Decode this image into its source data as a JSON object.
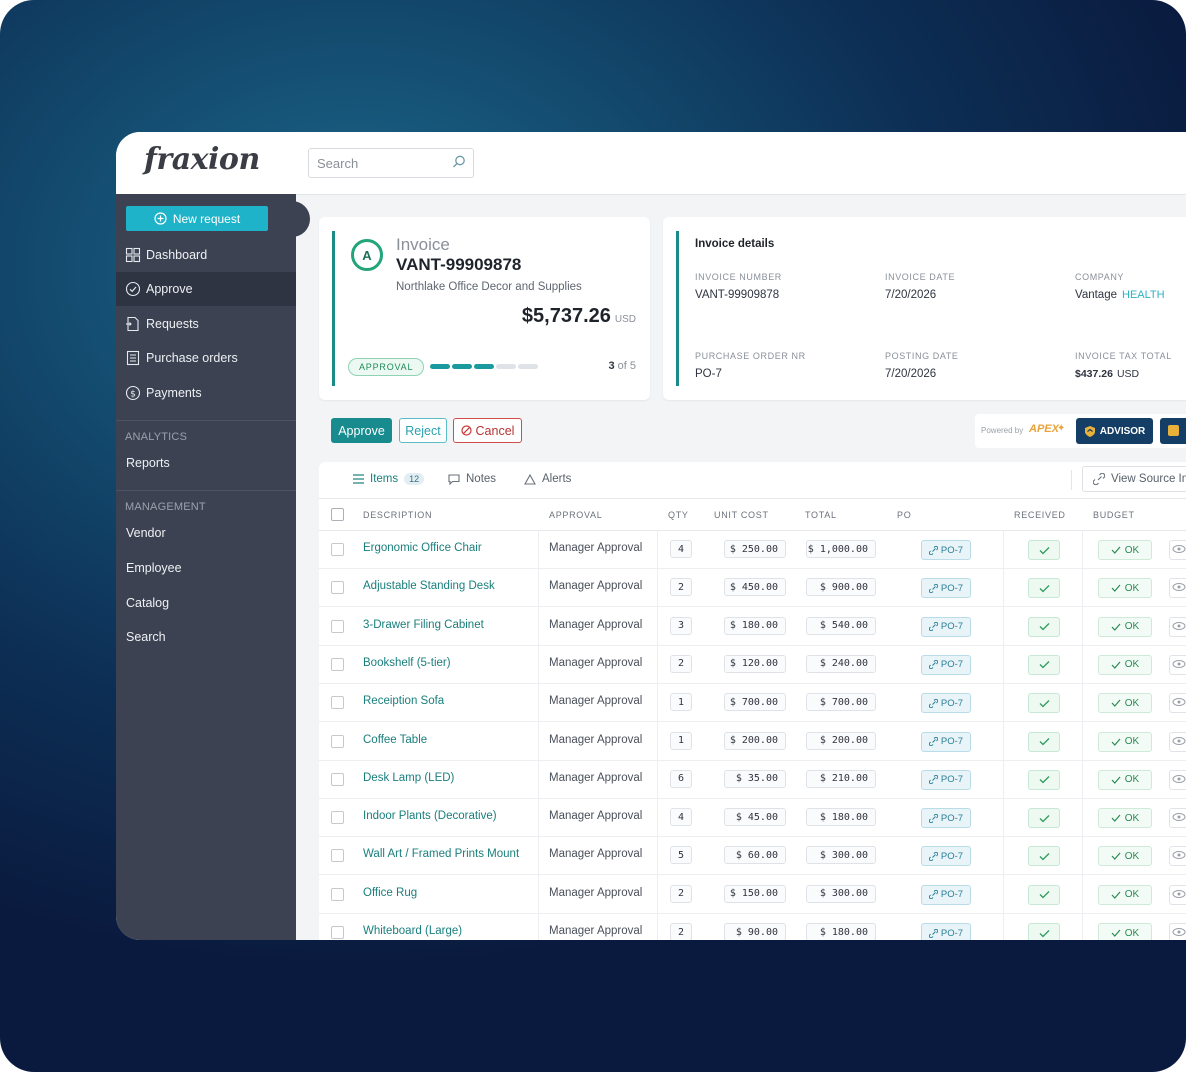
{
  "app": {
    "logo": "fraxion",
    "search_placeholder": "Search"
  },
  "sidebar": {
    "new_request": "New request",
    "items": [
      {
        "label": "Dashboard",
        "icon": "dashboard-icon"
      },
      {
        "label": "Approve",
        "icon": "check-circle-icon",
        "active": true
      },
      {
        "label": "Requests",
        "icon": "request-icon"
      },
      {
        "label": "Purchase orders",
        "icon": "document-icon"
      },
      {
        "label": "Payments",
        "icon": "dollar-icon"
      }
    ],
    "analytics_label": "ANALYTICS",
    "reports": "Reports",
    "management_label": "MANAGEMENT",
    "management": [
      "Vendor",
      "Employee",
      "Catalog",
      "Search"
    ]
  },
  "invoice": {
    "avatar": "A",
    "type": "Invoice",
    "number": "VANT-99909878",
    "vendor": "Northlake Office Decor and Supplies",
    "amount": "$5,737.26",
    "currency": "USD",
    "stage": "APPROVAL",
    "step": "3",
    "step_of": "of 5",
    "progress_filled": 3,
    "progress_total": 5
  },
  "details": {
    "title": "Invoice details",
    "invoice_number_label": "INVOICE NUMBER",
    "invoice_number": "VANT-99909878",
    "invoice_date_label": "INVOICE DATE",
    "invoice_date": "7/20/2026",
    "company_label": "COMPANY",
    "company": "Vantage",
    "company_tag": "HEALTH",
    "po_nr_label": "PURCHASE ORDER NR",
    "po_nr": "PO-7",
    "posting_date_label": "POSTING DATE",
    "posting_date": "7/20/2026",
    "tax_label": "INVOICE TAX TOTAL",
    "tax": "$437.26",
    "tax_currency": "USD"
  },
  "actions": {
    "approve": "Approve",
    "reject": "Reject",
    "cancel": "Cancel",
    "powered_by": "Powered by",
    "apex": "APEX",
    "advisor": "ADVISOR"
  },
  "tabs": {
    "items": "Items",
    "items_count": "12",
    "notes": "Notes",
    "alerts": "Alerts",
    "view_source": "View Source In"
  },
  "columns": {
    "description": "DESCRIPTION",
    "approval": "APPROVAL",
    "qty": "QTY",
    "unit_cost": "UNIT COST",
    "total": "TOTAL",
    "po": "PO",
    "received": "RECEIVED",
    "budget": "BUDGET"
  },
  "rows": [
    {
      "desc": "Ergonomic Office Chair",
      "approval": "Manager Approval",
      "qty": "4",
      "unit": "$ 250.00",
      "total": "$ 1,000.00",
      "po": "PO-7",
      "budget": "OK"
    },
    {
      "desc": "Adjustable Standing Desk",
      "approval": "Manager Approval",
      "qty": "2",
      "unit": "$ 450.00",
      "total": "$ 900.00",
      "po": "PO-7",
      "budget": "OK"
    },
    {
      "desc": "3-Drawer Filing Cabinet",
      "approval": "Manager Approval",
      "qty": "3",
      "unit": "$ 180.00",
      "total": "$ 540.00",
      "po": "PO-7",
      "budget": "OK"
    },
    {
      "desc": "Bookshelf (5-tier)",
      "approval": "Manager Approval",
      "qty": "2",
      "unit": "$ 120.00",
      "total": "$ 240.00",
      "po": "PO-7",
      "budget": "OK"
    },
    {
      "desc": "Receiption Sofa",
      "approval": "Manager Approval",
      "qty": "1",
      "unit": "$ 700.00",
      "total": "$ 700.00",
      "po": "PO-7",
      "budget": "OK"
    },
    {
      "desc": "Coffee Table",
      "approval": "Manager Approval",
      "qty": "1",
      "unit": "$ 200.00",
      "total": "$ 200.00",
      "po": "PO-7",
      "budget": "OK"
    },
    {
      "desc": "Desk Lamp (LED)",
      "approval": "Manager Approval",
      "qty": "6",
      "unit": "$ 35.00",
      "total": "$ 210.00",
      "po": "PO-7",
      "budget": "OK"
    },
    {
      "desc": "Indoor Plants (Decorative)",
      "approval": "Manager Approval",
      "qty": "4",
      "unit": "$ 45.00",
      "total": "$ 180.00",
      "po": "PO-7",
      "budget": "OK"
    },
    {
      "desc": "Wall Art / Framed Prints Mount",
      "approval": "Manager Approval",
      "qty": "5",
      "unit": "$ 60.00",
      "total": "$ 300.00",
      "po": "PO-7",
      "budget": "OK"
    },
    {
      "desc": "Office Rug",
      "approval": "Manager Approval",
      "qty": "2",
      "unit": "$ 150.00",
      "total": "$ 300.00",
      "po": "PO-7",
      "budget": "OK"
    },
    {
      "desc": "Whiteboard (Large)",
      "approval": "Manager Approval",
      "qty": "2",
      "unit": "$ 90.00",
      "total": "$ 180.00",
      "po": "PO-7",
      "budget": "OK"
    }
  ],
  "colors": {
    "accent": "#1fb3c9",
    "teal_text": "#197f7c",
    "sidebar": "#3c4252",
    "ok_green": "#2b8a54"
  }
}
